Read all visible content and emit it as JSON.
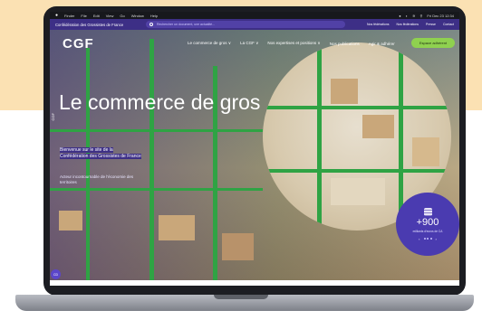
{
  "menubar": {
    "apple": "",
    "items": [
      "Finder",
      "File",
      "Edit",
      "View",
      "Go",
      "Window",
      "Help"
    ],
    "right": [
      "●",
      "◐",
      "≋",
      "⚲",
      "Fri Dec 23 12:34"
    ]
  },
  "topbar": {
    "brand": "Confédération des Grossistes de France",
    "search_placeholder": "Rechercher un document, une actualité...",
    "links": [
      "Nos fédérations",
      "Nos fédérations",
      "Presse",
      "Contact"
    ]
  },
  "logo": "CGF",
  "nav": [
    "Le commerce de gros ∨",
    "La CGF ∨",
    "Nos expertises et positions ∨",
    "Nos publications",
    "Agir & adhérer"
  ],
  "member_button": "Espace adhérent",
  "side_label": "CGF",
  "hero": {
    "title": "Le commerce de gros",
    "desc": "Bienvenue sur le site de la Confédération des Grossistes de France",
    "sub": "Acteur incontournable de l'économie des territoires"
  },
  "stat": {
    "value": "+900",
    "label": "milliards d'euros de CA",
    "prev": "‹",
    "next": "›"
  },
  "chat_label": "CD",
  "colors": {
    "brand_purple": "#3d2f86",
    "accent_green": "#8fd14f",
    "stat_purple": "#4a3bb0",
    "peach": "#fbe1b3"
  }
}
